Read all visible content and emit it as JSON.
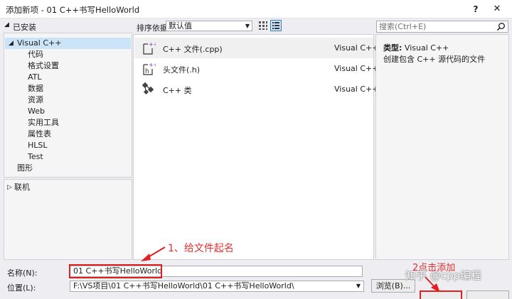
{
  "window": {
    "title": "添加新项 - 01 C++书写HelloWorld",
    "help_label": "?",
    "close_label": "✕"
  },
  "tree": {
    "header": "已安装",
    "root": "Visual C++",
    "children": [
      "代码",
      "格式设置",
      "ATL",
      "数据",
      "资源",
      "Web",
      "实用工具",
      "属性表",
      "HLSL",
      "Test"
    ],
    "sibling": "图形",
    "online": "联机"
  },
  "sort": {
    "label": "排序依据:",
    "value": "默认值"
  },
  "search": {
    "placeholder": "搜索(Ctrl+E)"
  },
  "templates": [
    {
      "name": "C++ 文件(.cpp)",
      "lang": "Visual C++",
      "icon": "cpp-file-icon",
      "selected": true
    },
    {
      "name": "头文件(.h)",
      "lang": "Visual C++",
      "icon": "header-file-icon",
      "selected": false
    },
    {
      "name": "C++ 类",
      "lang": "Visual C++",
      "icon": "cpp-class-icon",
      "selected": false
    }
  ],
  "detail": {
    "type_label": "类型:",
    "type_value": "Visual C++",
    "description": "创建包含 C++ 源代码的文件"
  },
  "annotations": {
    "step1": "1、给文件起名",
    "step2": "2点击添加"
  },
  "form": {
    "name_label": "名称(N):",
    "name_value": "01 C++书写HelloWorld",
    "location_label": "位置(L):",
    "location_value": "F:\\VS项目\\01 C++书写HelloWorld\\01 C++书写HelloWorld\\",
    "browse_label": "浏览(B)..."
  },
  "watermark": "知乎 @cpp编程",
  "colors": {
    "selection": "#cce4f7",
    "annotation": "#e02020"
  }
}
